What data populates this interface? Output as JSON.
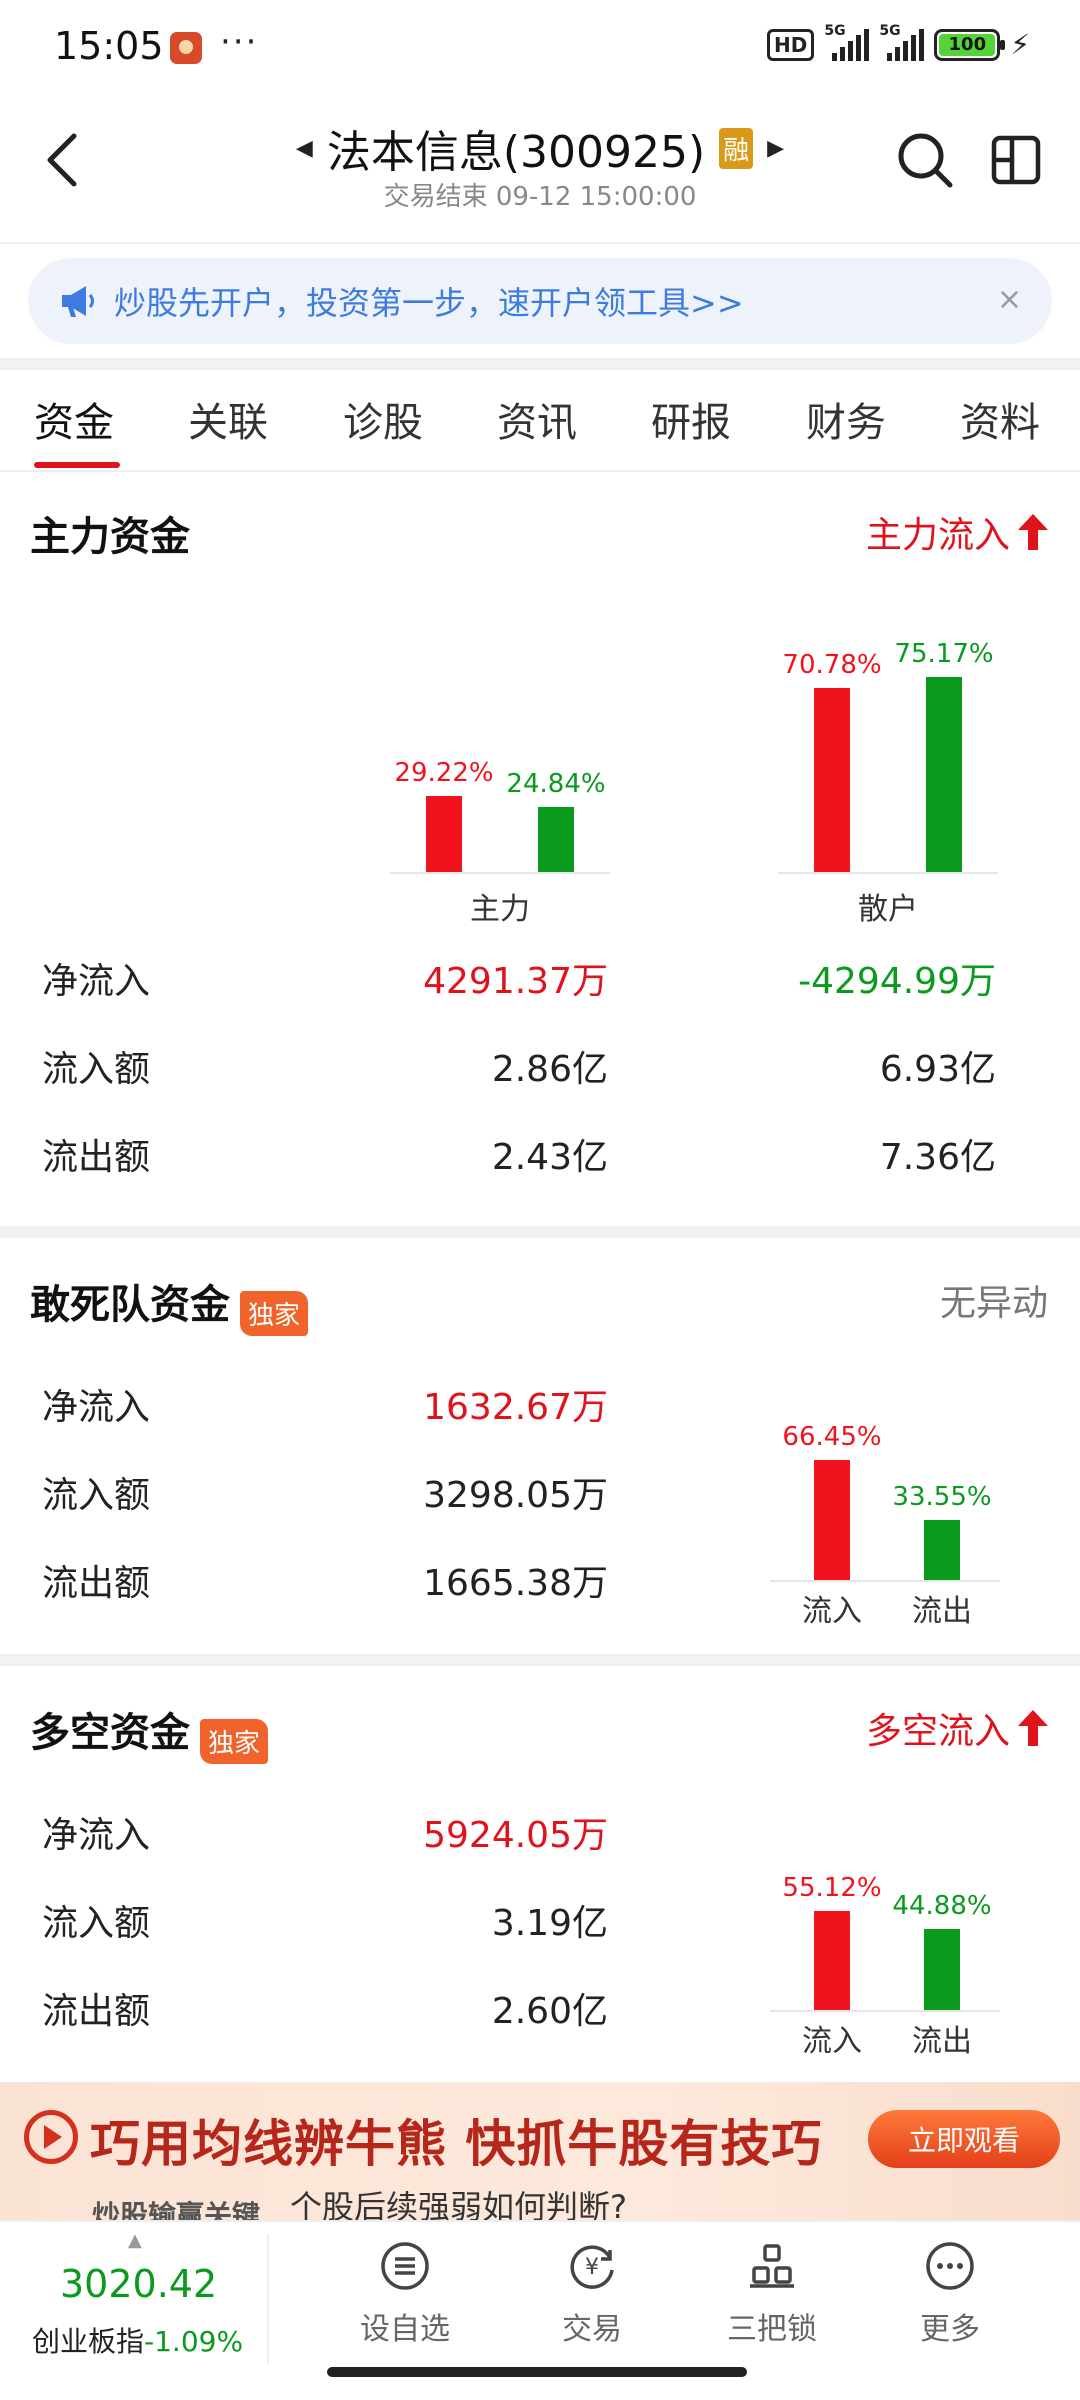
{
  "status_bar": {
    "time": "15:05",
    "more": "···",
    "hd": "HD",
    "signal1_type": "5G",
    "signal2_type": "5G",
    "battery": "100"
  },
  "header": {
    "stock_title": "法本信息(300925)",
    "margin_badge": "融",
    "subtitle": "交易结束 09-12 15:00:00"
  },
  "banner": {
    "text": "炒股先开户，投资第一步，速开户领工具>>",
    "close": "×"
  },
  "tabs": [
    "资金",
    "关联",
    "诊股",
    "资讯",
    "研报",
    "财务",
    "资料"
  ],
  "main_funds": {
    "title": "主力资金",
    "flow_tag": "主力流入",
    "rows": [
      {
        "label": "净流入",
        "main": "4291.37万",
        "retail": "-4294.99万"
      },
      {
        "label": "流入额",
        "main": "2.86亿",
        "retail": "6.93亿"
      },
      {
        "label": "流出额",
        "main": "2.43亿",
        "retail": "7.36亿"
      }
    ]
  },
  "dare_funds": {
    "title": "敢死队资金",
    "badge": "独家",
    "status": "无异动",
    "rows": [
      {
        "label": "净流入",
        "value": "1632.67万"
      },
      {
        "label": "流入额",
        "value": "3298.05万"
      },
      {
        "label": "流出额",
        "value": "1665.38万"
      }
    ]
  },
  "longshort_funds": {
    "title": "多空资金",
    "badge": "独家",
    "flow_tag": "多空流入",
    "rows": [
      {
        "label": "净流入",
        "value": "5924.05万"
      },
      {
        "label": "流入额",
        "value": "3.19亿"
      },
      {
        "label": "流出额",
        "value": "2.60亿"
      }
    ]
  },
  "chart_data": [
    {
      "type": "bar",
      "categories": [
        "主力",
        "散户"
      ],
      "series": [
        {
          "values": [
            29.22,
            70.78
          ],
          "color": "#f0121c"
        },
        {
          "values": [
            24.84,
            75.17
          ],
          "color": "#0a9a1e"
        }
      ],
      "labels": [
        [
          "29.22%",
          "24.84%"
        ],
        [
          "70.78%",
          "75.17%"
        ]
      ],
      "ylim": [
        0,
        100
      ]
    },
    {
      "type": "bar",
      "categories": [
        "流入",
        "流出"
      ],
      "values": [
        66.45,
        33.55
      ],
      "labels": [
        "66.45%",
        "33.55%"
      ],
      "ylim": [
        0,
        100
      ]
    },
    {
      "type": "bar",
      "categories": [
        "流入",
        "流出"
      ],
      "values": [
        55.12,
        44.88
      ],
      "labels": [
        "55.12%",
        "44.88%"
      ],
      "ylim": [
        0,
        100
      ]
    }
  ],
  "ad": {
    "title": "巧用均线辨牛熊  快抓牛股有技巧",
    "button": "立即观看",
    "subtitle": "个股后续强弱如何判断?",
    "subtitle2": "炒股输赢关键"
  },
  "bottom_bar": {
    "index_value": "3020.42",
    "index_name": "创业板指",
    "index_change": "-1.09%",
    "nav": [
      "设自选",
      "交易",
      "三把锁",
      "更多"
    ]
  },
  "colors": {
    "up": "#e0121c",
    "down": "#0a9a1e",
    "accent": "#3e7be0"
  }
}
